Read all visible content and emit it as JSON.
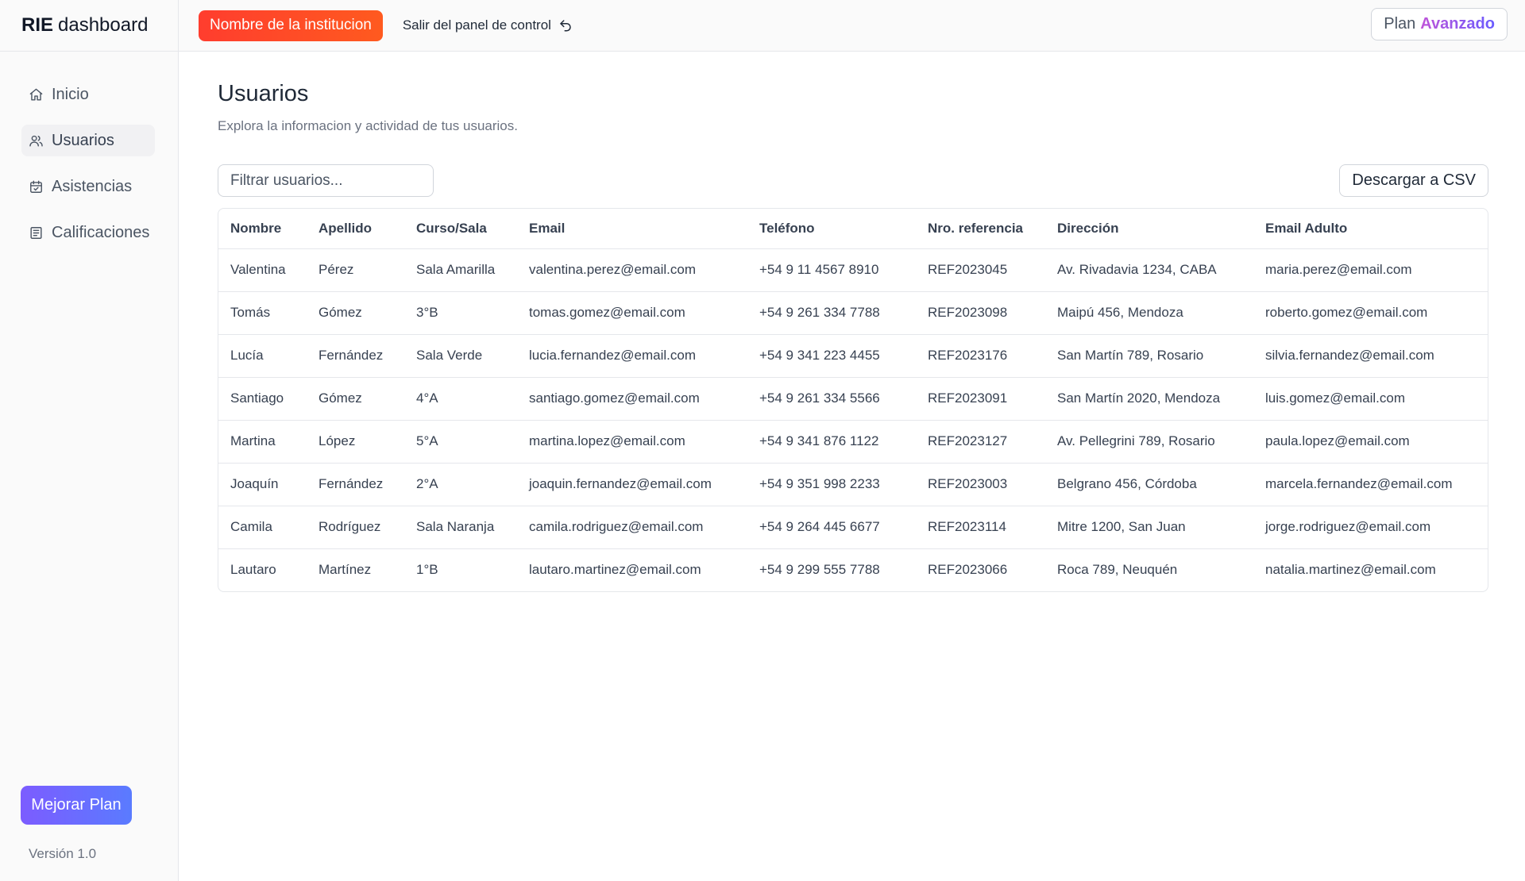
{
  "brand": {
    "strong": "RIE",
    "rest": "dashboard"
  },
  "topbar": {
    "institution_label": "Nombre de la institucion",
    "exit_label": "Salir del panel de control",
    "plan_label": "Plan",
    "plan_tier": "Avanzado"
  },
  "sidebar": {
    "items": [
      {
        "label": "Inicio",
        "icon": "home-icon",
        "active": false
      },
      {
        "label": "Usuarios",
        "icon": "users-icon",
        "active": true
      },
      {
        "label": "Asistencias",
        "icon": "calendar-check-icon",
        "active": false
      },
      {
        "label": "Calificaciones",
        "icon": "report-icon",
        "active": false
      }
    ],
    "upgrade_label": "Mejorar Plan",
    "version": "Versión 1.0"
  },
  "main": {
    "title": "Usuarios",
    "subtitle": "Explora la informacion y actividad de tus usuarios.",
    "filter_placeholder": "Filtrar usuarios...",
    "filter_value": "",
    "csv_label": "Descargar a CSV"
  },
  "table": {
    "columns": [
      "Nombre",
      "Apellido",
      "Curso/Sala",
      "Email",
      "Teléfono",
      "Nro. referencia",
      "Dirección",
      "Email Adulto"
    ],
    "rows": [
      [
        "Valentina",
        "Pérez",
        "Sala Amarilla",
        "valentina.perez@email.com",
        "+54 9 11 4567 8910",
        "REF2023045",
        "Av. Rivadavia 1234, CABA",
        "maria.perez@email.com"
      ],
      [
        "Tomás",
        "Gómez",
        "3°B",
        "tomas.gomez@email.com",
        "+54 9 261 334 7788",
        "REF2023098",
        "Maipú 456, Mendoza",
        "roberto.gomez@email.com"
      ],
      [
        "Lucía",
        "Fernández",
        "Sala Verde",
        "lucia.fernandez@email.com",
        "+54 9 341 223 4455",
        "REF2023176",
        "San Martín 789, Rosario",
        "silvia.fernandez@email.com"
      ],
      [
        "Santiago",
        "Gómez",
        "4°A",
        "santiago.gomez@email.com",
        "+54 9 261 334 5566",
        "REF2023091",
        "San Martín 2020, Mendoza",
        "luis.gomez@email.com"
      ],
      [
        "Martina",
        "López",
        "5°A",
        "martina.lopez@email.com",
        "+54 9 341 876 1122",
        "REF2023127",
        "Av. Pellegrini 789, Rosario",
        "paula.lopez@email.com"
      ],
      [
        "Joaquín",
        "Fernández",
        "2°A",
        "joaquin.fernandez@email.com",
        "+54 9 351 998 2233",
        "REF2023003",
        "Belgrano 456, Córdoba",
        "marcela.fernandez@email.com"
      ],
      [
        "Camila",
        "Rodríguez",
        "Sala Naranja",
        "camila.rodriguez@email.com",
        "+54 9 264 445 6677",
        "REF2023114",
        "Mitre 1200, San Juan",
        "jorge.rodriguez@email.com"
      ],
      [
        "Lautaro",
        "Martínez",
        "1°B",
        "lautaro.martinez@email.com",
        "+54 9 299 555 7788",
        "REF2023066",
        "Roca 789, Neuquén",
        "natalia.martinez@email.com"
      ]
    ]
  },
  "colors": {
    "institution_button": "#ff4a26",
    "upgrade_button": "#6b6cff",
    "plan_tier": "#8a5cf0"
  }
}
